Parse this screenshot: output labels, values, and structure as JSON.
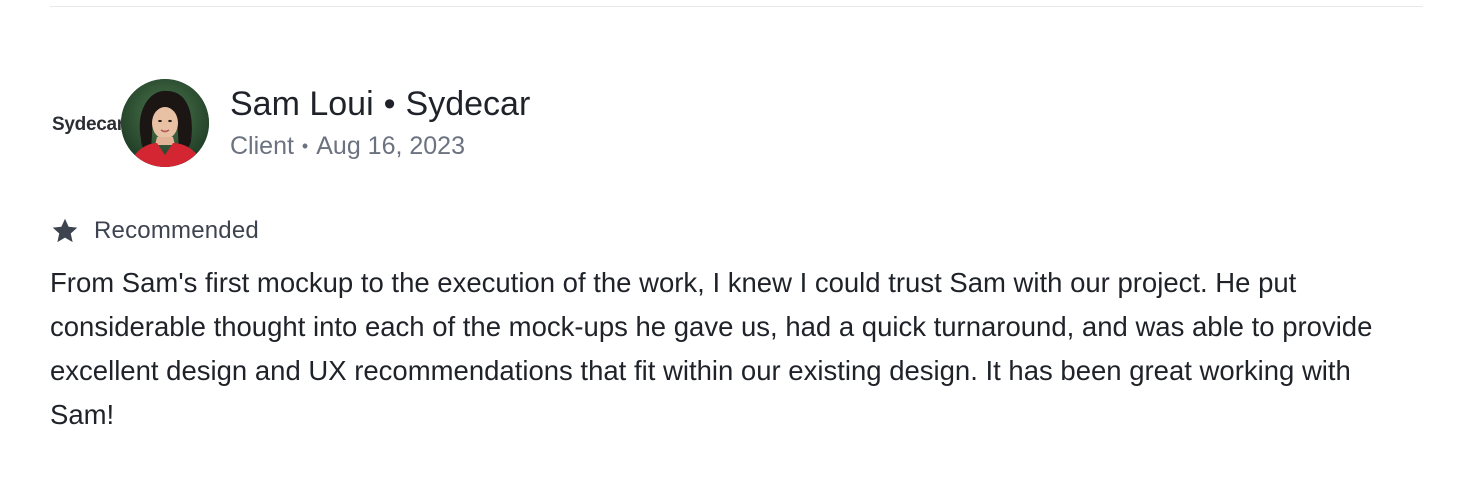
{
  "review": {
    "company_logo_text": "Sydecar",
    "reviewer_name": "Sam Loui",
    "company": "Sydecar",
    "separator": "•",
    "role": "Client",
    "date": "Aug 16, 2023",
    "badge": {
      "icon": "star-icon",
      "label": "Recommended"
    },
    "text": "From Sam's first mockup to the execution of the work, I knew I could trust Sam with our project. He put considerable thought into each of the mock-ups he gave us, had a quick turnaround, and was able to provide excellent design and UX recommendations that fit within our existing design. It has been great working with Sam!"
  },
  "colors": {
    "text_primary": "#1f2329",
    "text_secondary": "#6b7280",
    "star": "#3d4450",
    "divider": "#e6e8eb"
  }
}
